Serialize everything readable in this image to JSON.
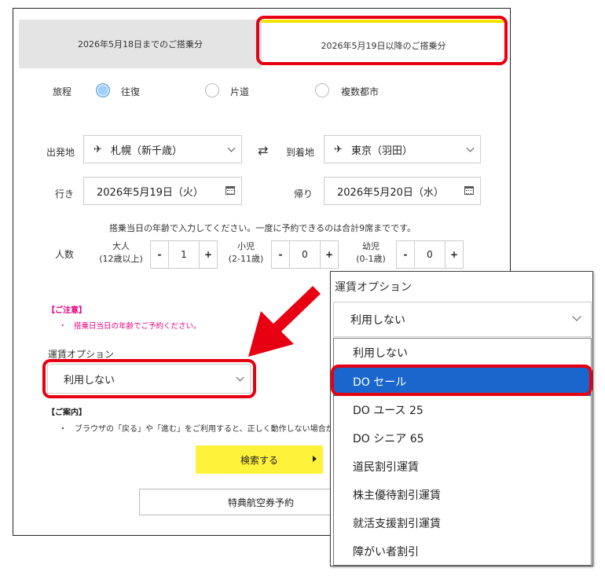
{
  "tabs": {
    "before": "2026年5月18日までのご搭乗分",
    "after": "2026年5月19日以降のご搭乗分"
  },
  "trip": {
    "label": "旅程",
    "options": [
      "往復",
      "片道",
      "複数都市"
    ],
    "selected": "往復"
  },
  "route": {
    "origin_label": "出発地",
    "origin_value": "札幌（新千歳）",
    "dest_label": "到着地",
    "dest_value": "東京（羽田）",
    "swap_icon": "⇄"
  },
  "dates": {
    "outbound_label": "行き",
    "outbound_value": "2026年5月19日（火）",
    "return_label": "帰り",
    "return_value": "2026年5月20日（水）"
  },
  "passengers": {
    "note": "搭乗当日の年齢で入力してください。一度に予約できるのは合計9席までです。",
    "label": "人数",
    "adult_label": "大人",
    "adult_sub": "(12歳以上)",
    "adult_count": "1",
    "child_label": "小児",
    "child_sub": "(2-11歳)",
    "child_count": "0",
    "infant_label": "幼児",
    "infant_sub": "(0-1歳)",
    "infant_count": "0",
    "minus": "-",
    "plus": "+"
  },
  "caution": {
    "title": "【ご注意】",
    "item": "・　搭乗日当日の年齢でご予約ください。"
  },
  "fare_option": {
    "label": "運賃オプション",
    "value": "利用しない"
  },
  "info": {
    "title": "【ご案内】",
    "item": "・　ブラウザの「戻る」や「進む」をご利用すると、正しく動作しない場合があり"
  },
  "buttons": {
    "search": "検索する",
    "award": "特典航空券予約"
  },
  "dropdown": {
    "title": "運賃オプション",
    "current": "利用しない",
    "options": [
      "利用しない",
      "DO セール",
      "DO ユース 25",
      "DO シニア 65",
      "道民割引運賃",
      "株主優待割引運賃",
      "就活支援割引運賃",
      "障がい者割引"
    ],
    "highlighted": "DO セール"
  },
  "colors": {
    "highlight_red": "#e60012",
    "accent_yellow": "#fff23a",
    "caution_pink": "#e6007e",
    "selected_blue": "#1a66cc"
  }
}
